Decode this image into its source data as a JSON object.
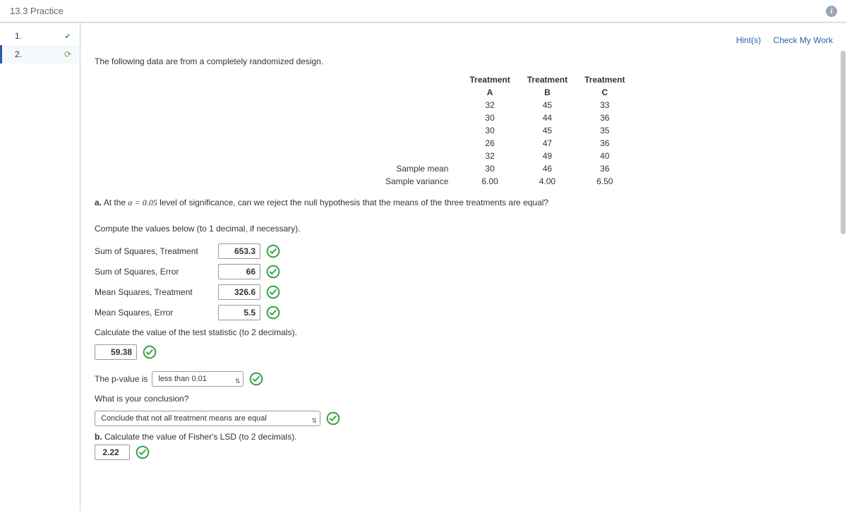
{
  "header": {
    "title": "13.3 Practice"
  },
  "nav": {
    "items": [
      {
        "num": "1.",
        "status": "done"
      },
      {
        "num": "2.",
        "status": "pending"
      }
    ]
  },
  "actions": {
    "hints": "Hint(s)",
    "check": "Check My Work"
  },
  "intro": "The following data are from a completely randomized design.",
  "tableHead": {
    "a": "Treatment",
    "b": "Treatment",
    "c": "Treatment",
    "a2": "A",
    "b2": "B",
    "c2": "C"
  },
  "rows": [
    {
      "a": "32",
      "b": "45",
      "c": "33"
    },
    {
      "a": "30",
      "b": "44",
      "c": "36"
    },
    {
      "a": "30",
      "b": "45",
      "c": "35"
    },
    {
      "a": "26",
      "b": "47",
      "c": "36"
    },
    {
      "a": "32",
      "b": "49",
      "c": "40"
    }
  ],
  "meanLabel": "Sample mean",
  "varLabel": "Sample variance",
  "mean": {
    "a": "30",
    "b": "46",
    "c": "36"
  },
  "var": {
    "a": "6.00",
    "b": "4.00",
    "c": "6.50"
  },
  "qa": {
    "prefix": "a.",
    "text1": "At the ",
    "alpha": "α = 0.05",
    "text2": " level of significance, can we reject the null hypothesis that the means of the three treatments are equal?"
  },
  "computeInst": "Compute the values below (to 1 decimal, if necessary).",
  "fields": {
    "sst": {
      "label": "Sum of Squares, Treatment",
      "value": "653.3"
    },
    "sse": {
      "label": "Sum of Squares, Error",
      "value": "66"
    },
    "mst": {
      "label": "Mean Squares, Treatment",
      "value": "326.6"
    },
    "mse": {
      "label": "Mean Squares, Error",
      "value": "5.5"
    }
  },
  "calcStatInst": "Calculate the value of the test statistic (to 2 decimals).",
  "fstat": "59.38",
  "pval": {
    "pre": "The p-value is",
    "sel": "less than 0.01"
  },
  "conclQ": "What is your conclusion?",
  "conclSel": "Conclude that not all treatment means are equal",
  "partB": {
    "label": "b.",
    "text": "Calculate the value of Fisher's LSD (to 2 decimals)."
  },
  "lsdCut": "2.22"
}
